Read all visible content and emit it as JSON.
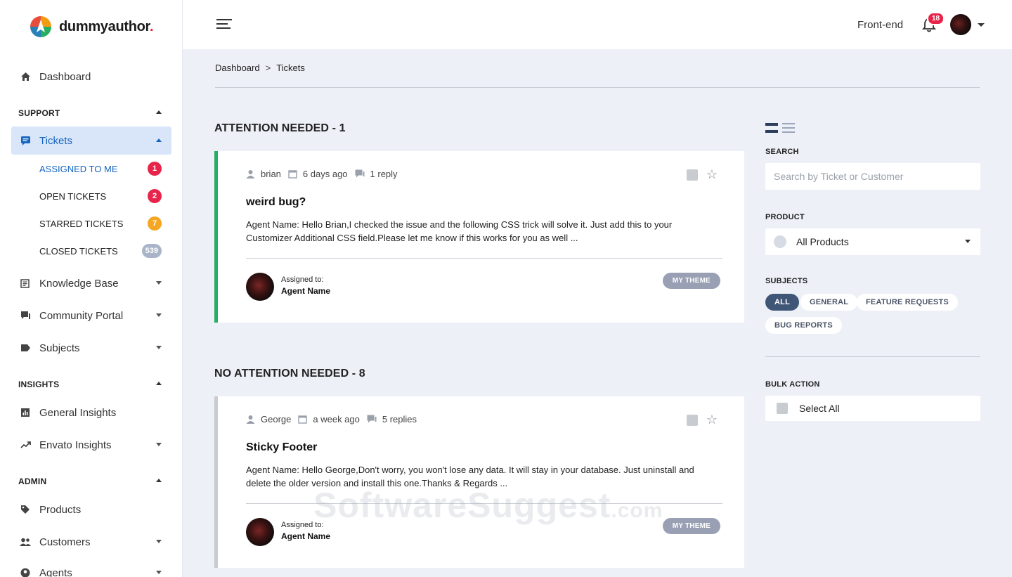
{
  "brand": {
    "name": "dummyauthor",
    "dot": "."
  },
  "sidebar": {
    "dashboard": "Dashboard",
    "support_head": "SUPPORT",
    "tickets": "Tickets",
    "sub": [
      {
        "label": "ASSIGNED TO ME",
        "count": "1",
        "color": "#e8244a"
      },
      {
        "label": "OPEN TICKETS",
        "count": "2",
        "color": "#e8244a"
      },
      {
        "label": "STARRED TICKETS",
        "count": "7",
        "color": "#f5a623"
      },
      {
        "label": "CLOSED TICKETS",
        "count": "539",
        "color": "#aab4c8"
      }
    ],
    "knowledge_base": "Knowledge Base",
    "community_portal": "Community Portal",
    "subjects": "Subjects",
    "insights_head": "INSIGHTS",
    "general_insights": "General Insights",
    "envato_insights": "Envato Insights",
    "admin_head": "ADMIN",
    "products": "Products",
    "customers": "Customers",
    "agents": "Agents"
  },
  "topbar": {
    "link": "Front-end",
    "notifications": "18"
  },
  "breadcrumb": {
    "root": "Dashboard",
    "sep": ">",
    "current": "Tickets"
  },
  "groups": {
    "attention": "ATTENTION NEEDED - 1",
    "no_attention": "NO ATTENTION NEEDED - 8"
  },
  "tickets": [
    {
      "user": "brian",
      "time": "6 days ago",
      "replies": "1 reply",
      "title": "weird bug?",
      "body": "Agent Name: Hello Brian,I checked the issue and the following CSS trick will solve it. Just add this to your Customizer Additional CSS field.Please let me know if this works for you as well ...",
      "assigned_label": "Assigned to:",
      "assigned_name": "Agent Name",
      "product": "MY THEME"
    },
    {
      "user": "George",
      "time": "a week ago",
      "replies": "5 replies",
      "title": "Sticky Footer",
      "body": "Agent Name: Hello George,Don't worry, you won't lose any data. It will stay in your database. Just uninstall and delete the older version and install this one.Thanks & Regards ...",
      "assigned_label": "Assigned to:",
      "assigned_name": "Agent Name",
      "product": "MY THEME"
    }
  ],
  "filters": {
    "search_label": "SEARCH",
    "search_placeholder": "Search by Ticket or Customer",
    "product_label": "PRODUCT",
    "product_value": "All Products",
    "subjects_label": "SUBJECTS",
    "subjects": [
      "ALL",
      "GENERAL",
      "FEATURE REQUESTS",
      "BUG REPORTS"
    ],
    "bulk_label": "BULK ACTION",
    "select_all": "Select All"
  },
  "watermark": {
    "main": "SoftwareSuggest",
    "suffix": ".com"
  },
  "colors": {
    "accent": "#1565c0",
    "attention_border": "#27ae60",
    "badge_red": "#e8244a",
    "badge_orange": "#f5a623",
    "chip_active": "#3f5677"
  }
}
